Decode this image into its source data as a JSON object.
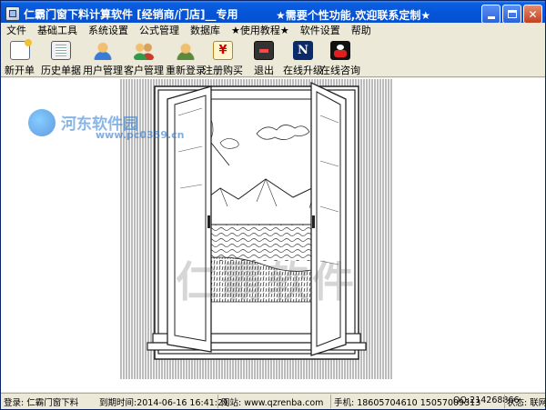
{
  "window": {
    "title": "仁霸门窗下料计算软件 [经销商/门店]__专用",
    "slogan": "★需要个性功能,欢迎联系定制★"
  },
  "menu": {
    "items": [
      "文件",
      "基础工具",
      "系统设置",
      "公式管理",
      "数据库",
      "★使用教程★",
      "软件设置",
      "帮助"
    ]
  },
  "toolbar": {
    "new_order": "新开单",
    "history": "历史单据",
    "user_mgmt": "用户管理",
    "client_mgmt": "客户管理",
    "relogin": "重新登录",
    "register": "注册购买",
    "exit": "退出",
    "upgrade": "在线升级",
    "consult": "在线咨询"
  },
  "watermarks": {
    "site_name": "河东软件园",
    "site_url": "www.pc0359.cn",
    "art_text": "仁霸软件"
  },
  "status": {
    "login": "登录: 仁霸门窗下料",
    "expire": "到期时间:2014-06-16 16:41:21",
    "website": "网站: www.qzrenba.com",
    "phone": "手机: 18605704610 15057009313",
    "qq": "QQ:214268866",
    "state": "状态: 联网"
  },
  "colors": {
    "titlebar": "#0554d8",
    "window_bg": "#ece9d8",
    "close_button": "#c3411f"
  },
  "icons": {
    "app": "app-window-icon",
    "new_order": "new-document-icon",
    "history": "document-list-icon",
    "user_mgmt": "user-icon",
    "client_mgmt": "users-group-icon",
    "relogin": "user-login-icon",
    "register": "register-coupon-icon",
    "exit": "exit-device-icon",
    "upgrade": "online-upgrade-icon",
    "consult": "qq-penguin-icon"
  }
}
